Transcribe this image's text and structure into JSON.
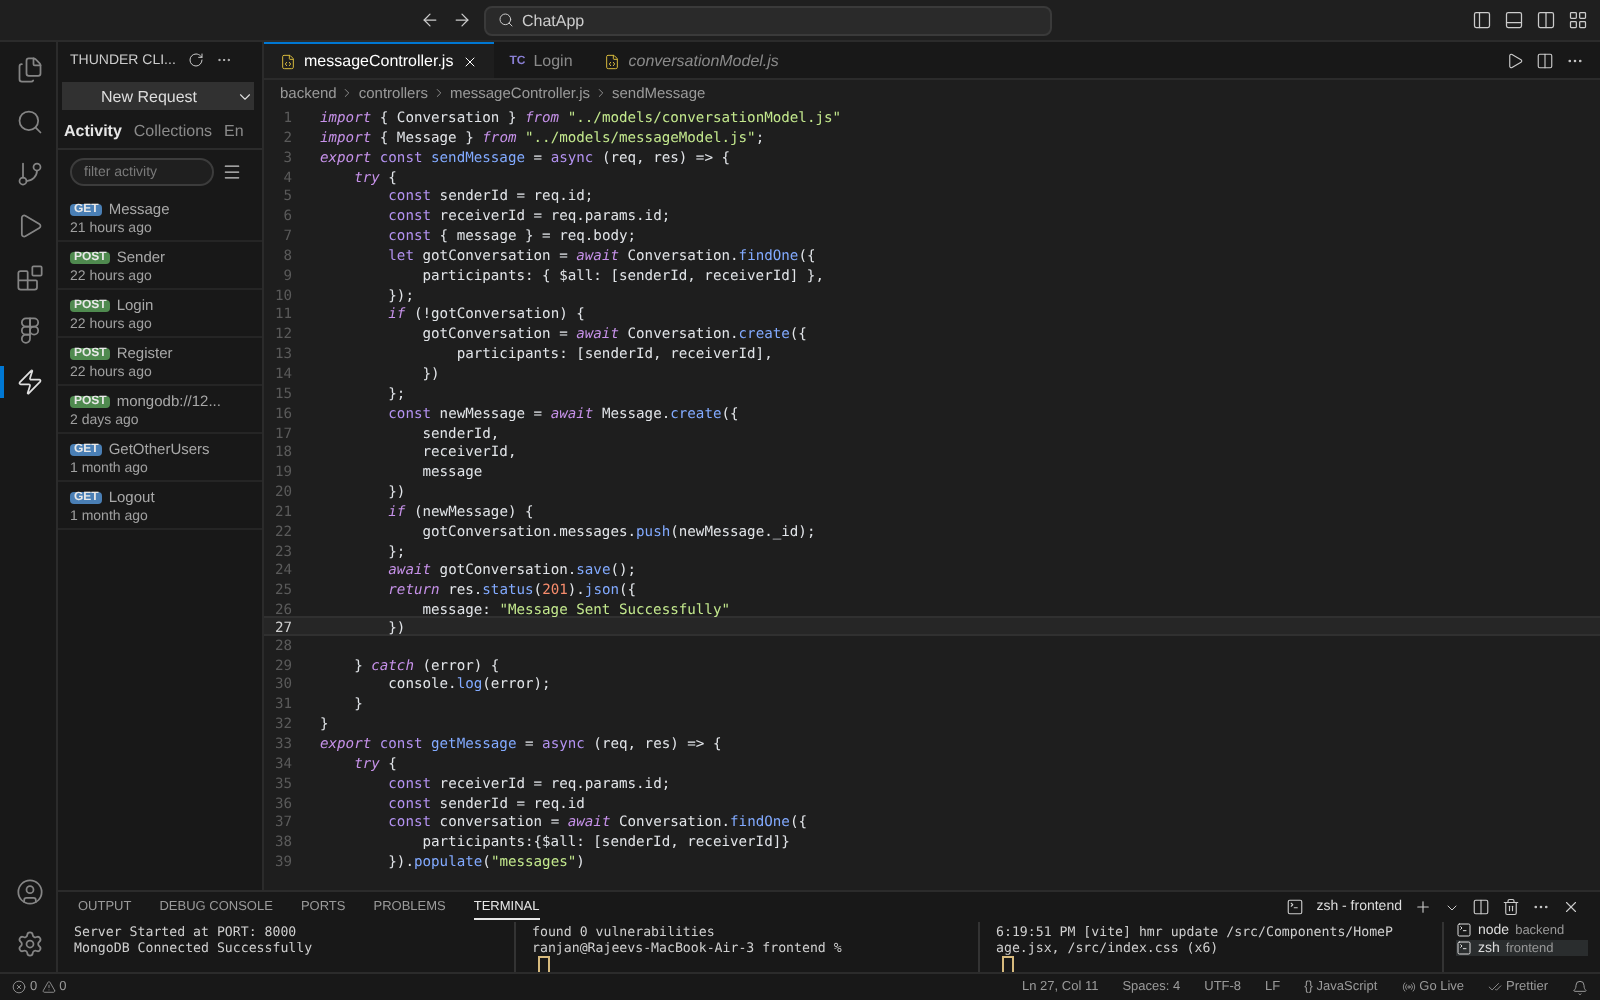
{
  "title_bar": {
    "search": "ChatApp"
  },
  "sidebar": {
    "title": "THUNDER CLI...",
    "new_request": "New Request",
    "tabs": [
      {
        "label": "Activity",
        "selected": true
      },
      {
        "label": "Collections",
        "selected": false
      },
      {
        "label": "En",
        "selected": false
      }
    ],
    "filter": {
      "placeholder": "filter activity"
    },
    "requests": [
      {
        "method": "GET",
        "color": "#4a7fb5",
        "name": "Message",
        "time": "21 hours ago"
      },
      {
        "method": "POST",
        "color": "#4f8a4f",
        "name": "Sender",
        "time": "22 hours ago"
      },
      {
        "method": "POST",
        "color": "#4f8a4f",
        "name": "Login",
        "time": "22 hours ago"
      },
      {
        "method": "POST",
        "color": "#4f8a4f",
        "name": "Register",
        "time": "22 hours ago"
      },
      {
        "method": "POST",
        "color": "#4f8a4f",
        "name": "mongodb://12...",
        "time": "2 days ago"
      },
      {
        "method": "GET",
        "color": "#4a7fb5",
        "name": "GetOtherUsers",
        "time": "1 month ago"
      },
      {
        "method": "GET",
        "color": "#4a7fb5",
        "name": "Logout",
        "time": "1 month ago"
      }
    ]
  },
  "editor": {
    "tabs": [
      {
        "label": "messageController.js",
        "kind": "js",
        "selected": true,
        "preview": false
      },
      {
        "label": "Login",
        "kind": "tc",
        "icon_text": "TC",
        "selected": false,
        "preview": false
      },
      {
        "label": "conversationModel.js",
        "kind": "js",
        "selected": false,
        "preview": true
      }
    ],
    "breadcrumb": [
      "backend",
      "controllers",
      "messageController.js",
      "sendMessage"
    ],
    "lines": [
      {
        "number": "1",
        "current": false,
        "segments": [
          {
            "kind": "k",
            "text": "import"
          },
          {
            "kind": "p",
            "text": " { Conversation } "
          },
          {
            "kind": "k",
            "text": "from"
          },
          {
            "kind": "s",
            "text": " \"../models/conversationModel.js\""
          }
        ]
      },
      {
        "number": "2",
        "current": false,
        "segments": [
          {
            "kind": "k",
            "text": "import"
          },
          {
            "kind": "p",
            "text": " { Message } "
          },
          {
            "kind": "k",
            "text": "from"
          },
          {
            "kind": "s",
            "text": " \"../models/messageModel.js\""
          },
          {
            "kind": "p",
            "text": ";"
          }
        ]
      },
      {
        "number": "3",
        "current": false,
        "segments": [
          {
            "kind": "k",
            "text": "export"
          },
          {
            "kind": "d",
            "text": " const"
          },
          {
            "kind": "f",
            "text": " sendMessage"
          },
          {
            "kind": "p",
            "text": " = "
          },
          {
            "kind": "d",
            "text": "async"
          },
          {
            "kind": "p",
            "text": " (req, res) => {"
          }
        ]
      },
      {
        "number": "4",
        "current": false,
        "segments": [
          {
            "kind": "k",
            "text": "    try"
          },
          {
            "kind": "p",
            "text": " {"
          }
        ]
      },
      {
        "number": "5",
        "current": false,
        "segments": [
          {
            "kind": "d",
            "text": "        const"
          },
          {
            "kind": "p",
            "text": " senderId = req.id;"
          }
        ]
      },
      {
        "number": "6",
        "current": false,
        "segments": [
          {
            "kind": "d",
            "text": "        const"
          },
          {
            "kind": "p",
            "text": " receiverId = req.params.id;"
          }
        ]
      },
      {
        "number": "7",
        "current": false,
        "segments": [
          {
            "kind": "d",
            "text": "        const"
          },
          {
            "kind": "p",
            "text": " { message } = req.body;"
          }
        ]
      },
      {
        "number": "8",
        "current": false,
        "segments": [
          {
            "kind": "d",
            "text": "        let"
          },
          {
            "kind": "p",
            "text": " gotConversation = "
          },
          {
            "kind": "k",
            "text": "await"
          },
          {
            "kind": "p",
            "text": " Conversation."
          },
          {
            "kind": "f",
            "text": "findOne"
          },
          {
            "kind": "p",
            "text": "({"
          }
        ]
      },
      {
        "number": "9",
        "current": false,
        "segments": [
          {
            "kind": "p",
            "text": "            participants: { $all: [senderId, receiverId] },"
          }
        ]
      },
      {
        "number": "10",
        "current": false,
        "segments": [
          {
            "kind": "p",
            "text": "        });"
          }
        ]
      },
      {
        "number": "11",
        "current": false,
        "segments": [
          {
            "kind": "k",
            "text": "        if"
          },
          {
            "kind": "p",
            "text": " (!gotConversation) {"
          }
        ]
      },
      {
        "number": "12",
        "current": false,
        "segments": [
          {
            "kind": "p",
            "text": "            gotConversation = "
          },
          {
            "kind": "k",
            "text": "await"
          },
          {
            "kind": "p",
            "text": " Conversation."
          },
          {
            "kind": "f",
            "text": "create"
          },
          {
            "kind": "p",
            "text": "({"
          }
        ]
      },
      {
        "number": "13",
        "current": false,
        "segments": [
          {
            "kind": "p",
            "text": "                participants: [senderId, receiverId],"
          }
        ]
      },
      {
        "number": "14",
        "current": false,
        "segments": [
          {
            "kind": "p",
            "text": "            })"
          }
        ]
      },
      {
        "number": "15",
        "current": false,
        "segments": [
          {
            "kind": "p",
            "text": "        };"
          }
        ]
      },
      {
        "number": "16",
        "current": false,
        "segments": [
          {
            "kind": "d",
            "text": "        const"
          },
          {
            "kind": "p",
            "text": " newMessage = "
          },
          {
            "kind": "k",
            "text": "await"
          },
          {
            "kind": "p",
            "text": " Message."
          },
          {
            "kind": "f",
            "text": "create"
          },
          {
            "kind": "p",
            "text": "({"
          }
        ]
      },
      {
        "number": "17",
        "current": false,
        "segments": [
          {
            "kind": "p",
            "text": "            senderId,"
          }
        ]
      },
      {
        "number": "18",
        "current": false,
        "segments": [
          {
            "kind": "p",
            "text": "            receiverId,"
          }
        ]
      },
      {
        "number": "19",
        "current": false,
        "segments": [
          {
            "kind": "p",
            "text": "            message"
          }
        ]
      },
      {
        "number": "20",
        "current": false,
        "segments": [
          {
            "kind": "p",
            "text": "        })"
          }
        ]
      },
      {
        "number": "21",
        "current": false,
        "segments": [
          {
            "kind": "k",
            "text": "        if"
          },
          {
            "kind": "p",
            "text": " (newMessage) {"
          }
        ]
      },
      {
        "number": "22",
        "current": false,
        "segments": [
          {
            "kind": "p",
            "text": "            gotConversation.messages."
          },
          {
            "kind": "f",
            "text": "push"
          },
          {
            "kind": "p",
            "text": "(newMessage._id);"
          }
        ]
      },
      {
        "number": "23",
        "current": false,
        "segments": [
          {
            "kind": "p",
            "text": "        };"
          }
        ]
      },
      {
        "number": "24",
        "current": false,
        "segments": [
          {
            "kind": "k",
            "text": "        await"
          },
          {
            "kind": "p",
            "text": " gotConversation."
          },
          {
            "kind": "f",
            "text": "save"
          },
          {
            "kind": "p",
            "text": "();"
          }
        ]
      },
      {
        "number": "25",
        "current": false,
        "segments": [
          {
            "kind": "k",
            "text": "        return"
          },
          {
            "kind": "p",
            "text": " res."
          },
          {
            "kind": "f",
            "text": "status"
          },
          {
            "kind": "p",
            "text": "("
          },
          {
            "kind": "n",
            "text": "201"
          },
          {
            "kind": "p",
            "text": ")."
          },
          {
            "kind": "f",
            "text": "json"
          },
          {
            "kind": "p",
            "text": "({"
          }
        ]
      },
      {
        "number": "26",
        "current": false,
        "segments": [
          {
            "kind": "p",
            "text": "            message: "
          },
          {
            "kind": "s",
            "text": "\"Message Sent Successfully\""
          }
        ]
      },
      {
        "number": "27",
        "current": true,
        "segments": [
          {
            "kind": "p",
            "text": "        })"
          }
        ]
      },
      {
        "number": "28",
        "current": false
      },
      {
        "number": "29",
        "current": false,
        "segments": [
          {
            "kind": "p",
            "text": "    } "
          },
          {
            "kind": "k",
            "text": "catch"
          },
          {
            "kind": "p",
            "text": " (error) {"
          }
        ]
      },
      {
        "number": "30",
        "current": false,
        "segments": [
          {
            "kind": "p",
            "text": "        console."
          },
          {
            "kind": "f",
            "text": "log"
          },
          {
            "kind": "p",
            "text": "(error);"
          }
        ]
      },
      {
        "number": "31",
        "current": false,
        "segments": [
          {
            "kind": "p",
            "text": "    }"
          }
        ]
      },
      {
        "number": "32",
        "current": false,
        "segments": [
          {
            "kind": "p",
            "text": "}"
          }
        ]
      },
      {
        "number": "33",
        "current": false,
        "segments": [
          {
            "kind": "k",
            "text": "export"
          },
          {
            "kind": "d",
            "text": " const"
          },
          {
            "kind": "f",
            "text": " getMessage"
          },
          {
            "kind": "p",
            "text": " = "
          },
          {
            "kind": "d",
            "text": "async"
          },
          {
            "kind": "p",
            "text": " (req, res) => {"
          }
        ]
      },
      {
        "number": "34",
        "current": false,
        "segments": [
          {
            "kind": "k",
            "text": "    try"
          },
          {
            "kind": "p",
            "text": " {"
          }
        ]
      },
      {
        "number": "35",
        "current": false,
        "segments": [
          {
            "kind": "d",
            "text": "        const"
          },
          {
            "kind": "p",
            "text": " receiverId = req.params.id;"
          }
        ]
      },
      {
        "number": "36",
        "current": false,
        "segments": [
          {
            "kind": "d",
            "text": "        const"
          },
          {
            "kind": "p",
            "text": " senderId = req.id"
          }
        ]
      },
      {
        "number": "37",
        "current": false,
        "segments": [
          {
            "kind": "d",
            "text": "        const"
          },
          {
            "kind": "p",
            "text": " conversation = "
          },
          {
            "kind": "k",
            "text": "await"
          },
          {
            "kind": "p",
            "text": " Conversation."
          },
          {
            "kind": "f",
            "text": "findOne"
          },
          {
            "kind": "p",
            "text": "({"
          }
        ]
      },
      {
        "number": "38",
        "current": false,
        "segments": [
          {
            "kind": "p",
            "text": "            participants:{$all: [senderId, receiverId]}"
          }
        ]
      },
      {
        "number": "39",
        "current": false,
        "segments": [
          {
            "kind": "p",
            "text": "        })."
          },
          {
            "kind": "f",
            "text": "populate"
          },
          {
            "kind": "p",
            "text": "("
          },
          {
            "kind": "s",
            "text": "\"messages\""
          },
          {
            "kind": "p",
            "text": ")"
          }
        ]
      }
    ]
  },
  "panel": {
    "tabs": [
      {
        "label": "OUTPUT",
        "selected": false
      },
      {
        "label": "DEBUG CONSOLE",
        "selected": false
      },
      {
        "label": "PORTS",
        "selected": false
      },
      {
        "label": "PROBLEMS",
        "selected": false
      },
      {
        "label": "TERMINAL",
        "selected": true
      }
    ],
    "active_terminal": "zsh - frontend",
    "terminals": [
      {
        "lines": [
          "Server Started at PORT: 8000",
          "MongoDB Connected Successfully"
        ]
      },
      {
        "lines": [
          "found 0 vulnerabilities",
          "ranjan@Rajeevs-MacBook-Air-3 frontend %"
        ]
      },
      {
        "lines": [
          "6:19:51 PM [vite] hmr update /src/Components/HomeP",
          "age.jsx, /src/index.css (x6)"
        ]
      }
    ],
    "terminal_list": [
      {
        "name": "node",
        "folder": "backend",
        "selected": false
      },
      {
        "name": "zsh",
        "folder": "frontend",
        "selected": true
      }
    ]
  },
  "status_bar": {
    "errors": "0",
    "warnings": "0",
    "items": [
      "Ln 27, Col 11",
      "Spaces: 4",
      "UTF-8",
      "LF",
      "{} JavaScript",
      "Go Live",
      "Prettier"
    ]
  }
}
